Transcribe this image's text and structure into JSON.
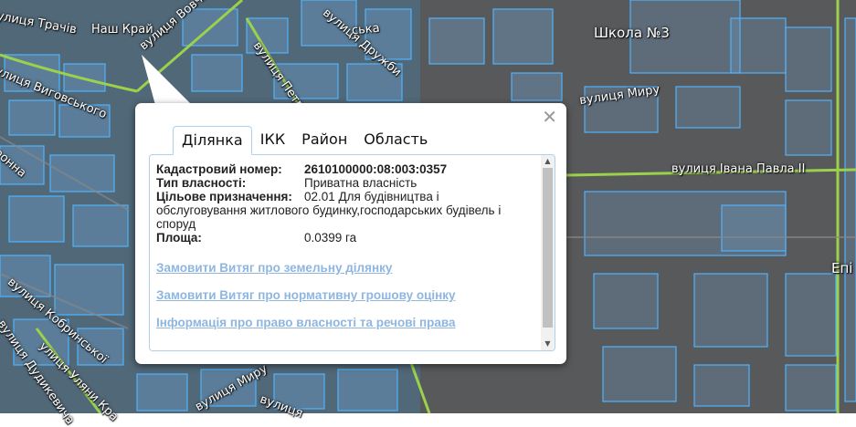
{
  "map": {
    "labels": {
      "trachiv": "улиця Трачів",
      "nash_krai": "Наш Край",
      "vovchynetska": "вулиця Вовчинецька",
      "petrushevycha": "вулиця Петрушевича",
      "druzhby": "вулиця Дружби",
      "vyhovskoho": "улиця Виговського",
      "ronna": "ронна",
      "shkola": "Школа №3",
      "myru_top": "вулиця Миру",
      "ivana_pavla": "вулиця Івана Павла ІІ",
      "kobrynskoi": "вулиця Кобринської",
      "dudykevycha": "вулиця Дудикевича",
      "ulyana_kr": "улиця Уляни Кра",
      "myru_bottom": "вулиця Миру",
      "vulytsia_bottom": "вулиця",
      "epi": "Епі",
      "ska": "ська"
    }
  },
  "popup": {
    "close_symbol": "✕",
    "tabs": [
      "Ділянка",
      "ІКК",
      "Район",
      "Область"
    ],
    "active_tab": 0,
    "fields": {
      "cadastral_label": "Кадастровий номер:",
      "cadastral_value": "2610100000:08:003:0357",
      "ownership_label": "Тип власності:",
      "ownership_value": "Приватна власність",
      "purpose_label": "Цільове призначення:",
      "purpose_value_line1": "02.01 Для будівництва і",
      "purpose_value_rest": "обслуговування житлового будинку,господарських будівель і споруд",
      "area_label": "Площа:",
      "area_value": "0.0399 га"
    },
    "links": [
      "Замовити Витяг про земельну ділянку",
      "Замовити Витяг про нормативну грошову оцінку",
      "Інформація про право власності та речові права"
    ],
    "scroll_up": "▲",
    "scroll_down": "▼"
  },
  "colors": {
    "parcel_outline": "#4fb3ff",
    "road_green": "#9bd14b",
    "link_color": "#8fb6df",
    "tab_border": "#aed0ea"
  }
}
